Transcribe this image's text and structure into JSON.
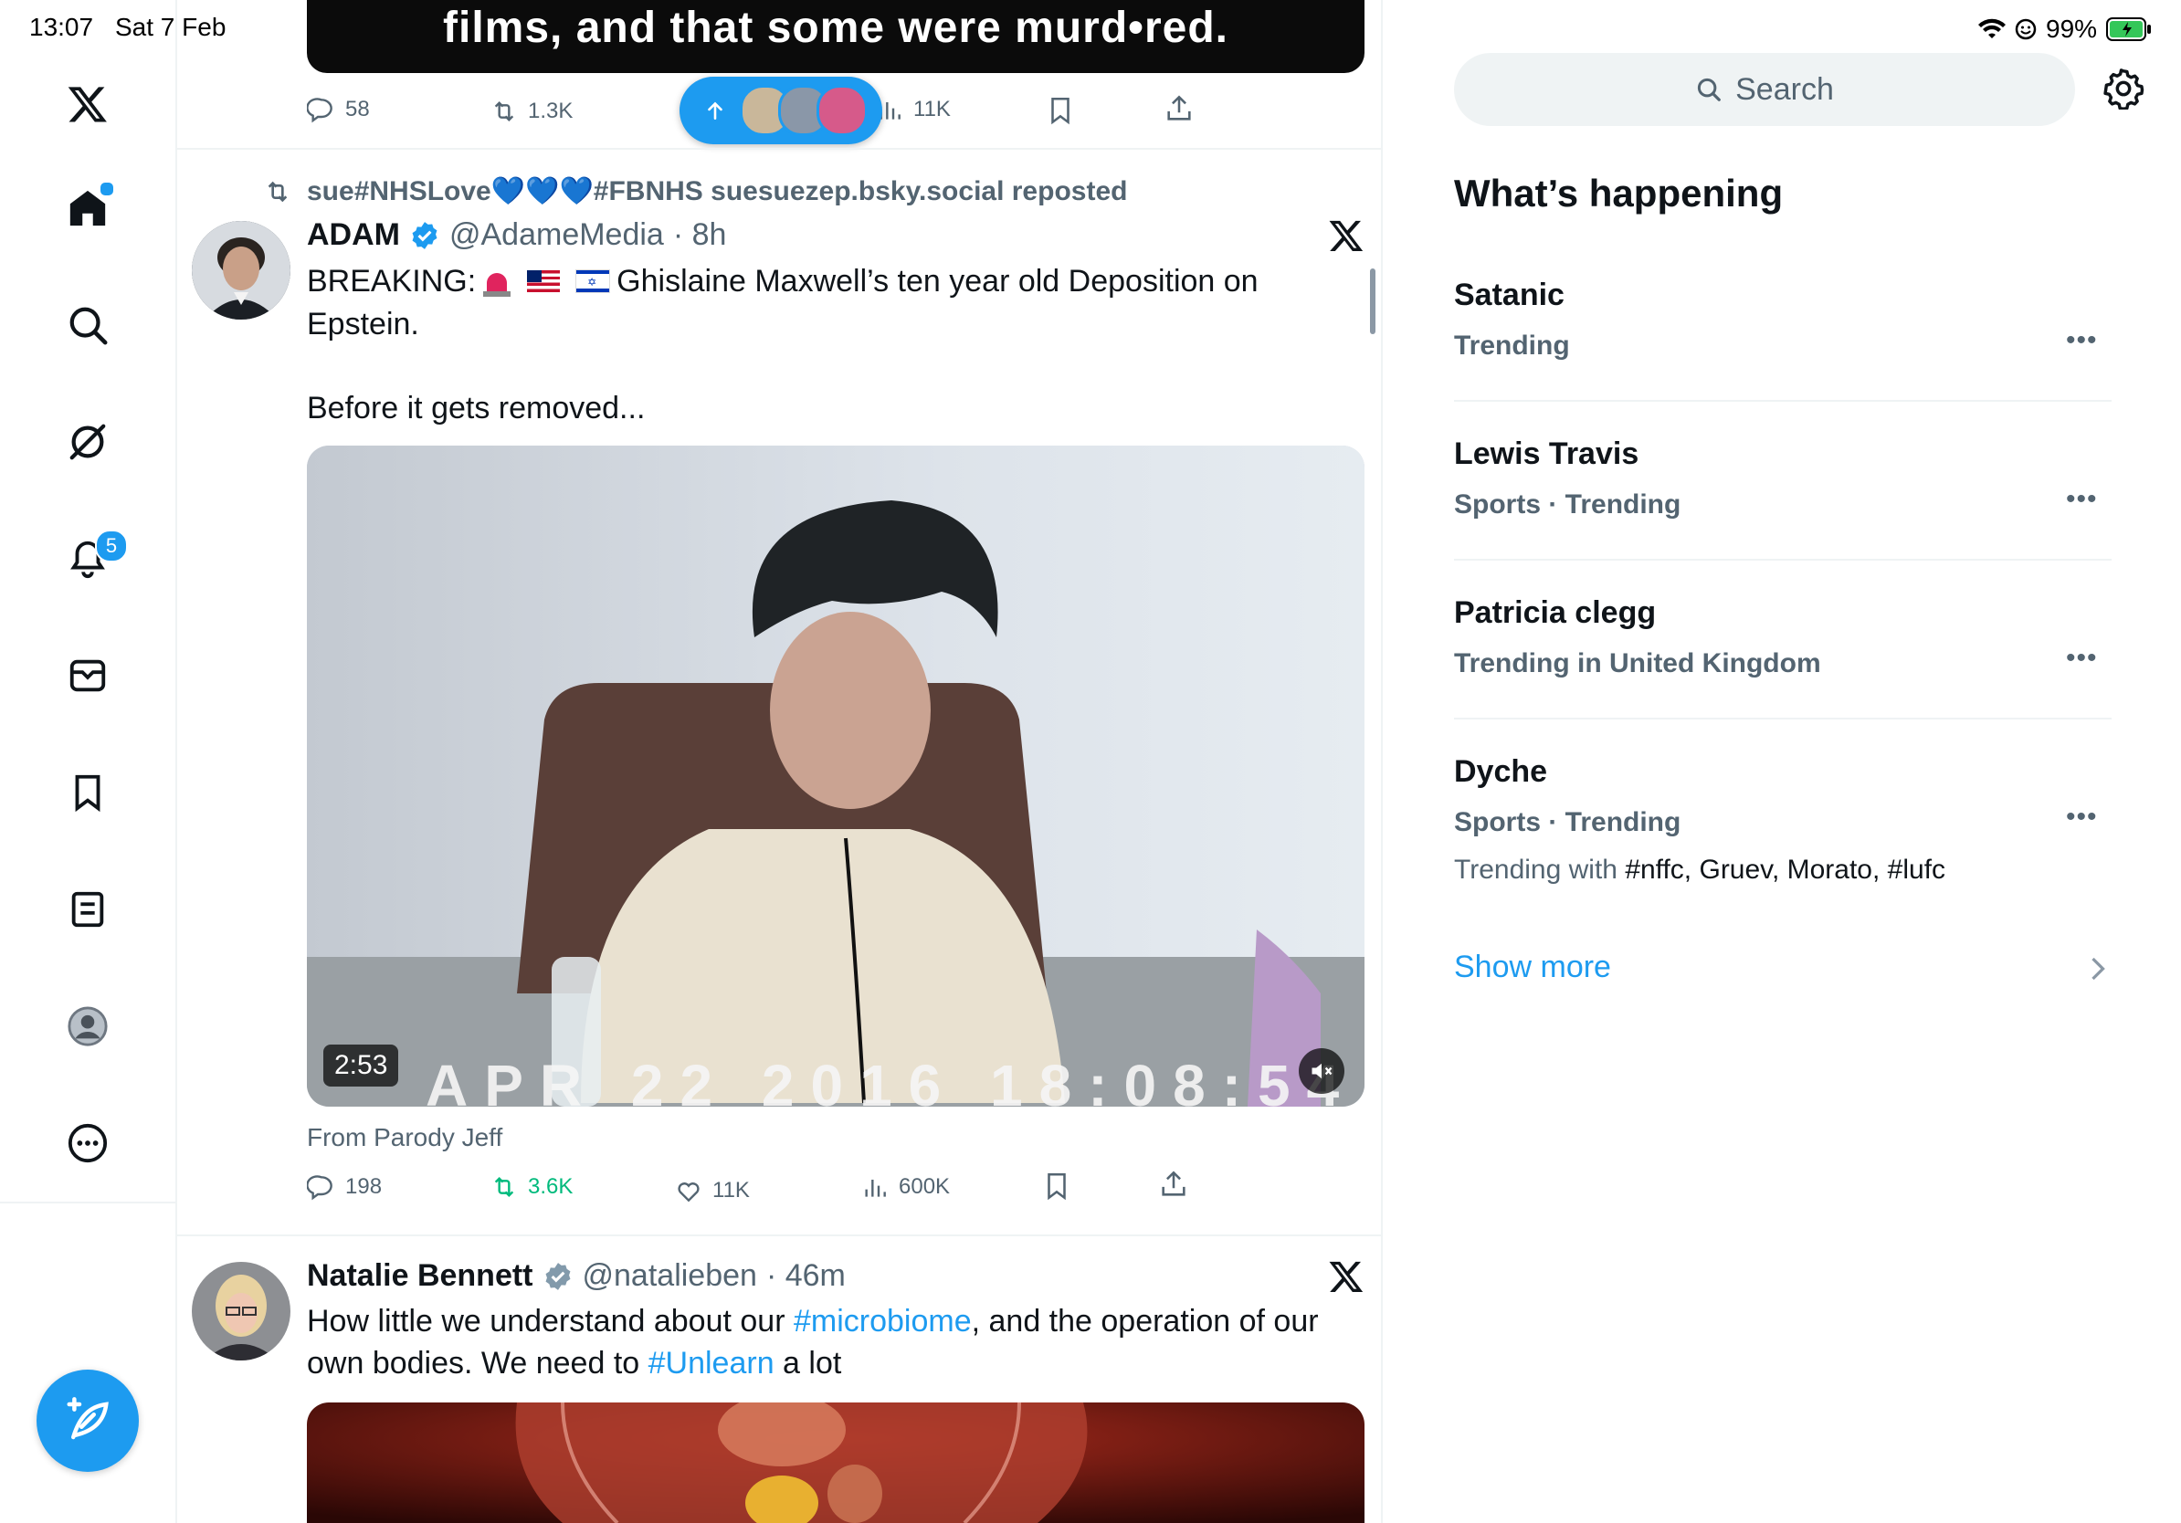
{
  "status_bar": {
    "time": "13:07",
    "date": "Sat 7 Feb",
    "battery": "99%"
  },
  "nav": {
    "notifications_badge": "5",
    "items": [
      "x-logo-icon",
      "home-icon",
      "search-icon",
      "grok-icon",
      "notifications-icon",
      "messages-icon",
      "bookmarks-icon",
      "lists-icon",
      "profile-icon",
      "more-icon"
    ]
  },
  "top_tweet": {
    "caption": "films, and that some were murd•red.",
    "replies": "58",
    "reposts": "1.3K",
    "views": "11K"
  },
  "tweet1": {
    "reposted_by": "sue#NHSLove💙💙💙#FBNHS suesuezep.bsky.social reposted",
    "name": "ADAM",
    "handle": "@AdameMedia",
    "time": "· 8h",
    "text_line1_a": "BREAKING: ",
    "text_line1_b": " Ghislaine Maxwell’s ten year old Deposition on",
    "text_line2": "Epstein.",
    "text_line3": "Before it gets removed...",
    "video_duration": "2:53",
    "video_overlay_text": "APR 22 2016 18:08:54",
    "attribution": "From Parody Jeff",
    "replies": "198",
    "reposts": "3.6K",
    "likes": "11K",
    "views": "600K"
  },
  "tweet2": {
    "name": "Natalie Bennett",
    "handle": "@natalieben",
    "time": "· 46m",
    "text_a": "How little we understand about our ",
    "hashtag1": "#microbiome",
    "text_b": ", and the operation of our",
    "text_c": "own bodies. We need to ",
    "hashtag2": "#Unlearn",
    "text_d": " a lot"
  },
  "search": {
    "placeholder": "Search"
  },
  "whats_happening": {
    "title": "What’s happening",
    "trends": [
      {
        "name": "Satanic",
        "context": "Trending"
      },
      {
        "name": "Lewis Travis",
        "context": "Sports · Trending"
      },
      {
        "name": "Patricia clegg",
        "context": "Trending in United Kingdom"
      },
      {
        "name": "Dyche",
        "context": "Sports · Trending",
        "with_label": "Trending with ",
        "with_tags": "#nffc, Gruev, Morato, #lufc"
      }
    ],
    "show_more": "Show more"
  },
  "colors": {
    "accent": "#1d9bf0",
    "repost_green": "#00ba7c",
    "secondary_text": "#536471"
  }
}
